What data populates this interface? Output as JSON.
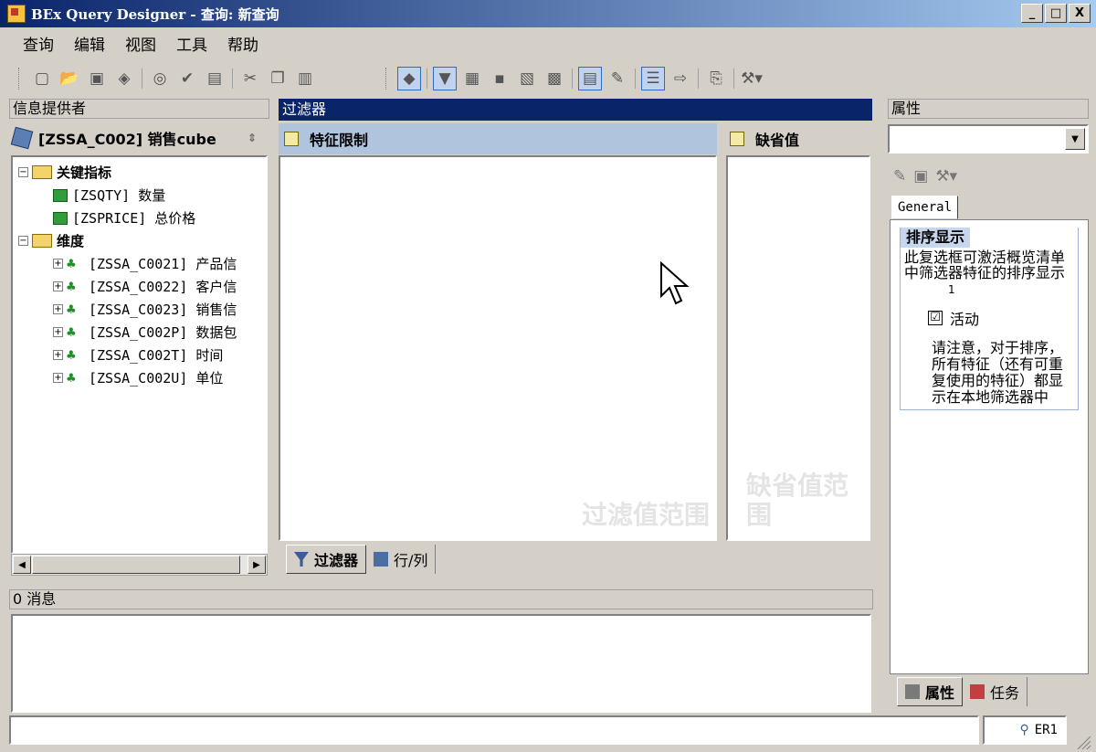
{
  "window": {
    "title": "BEx Query Designer - 查询: 新查询",
    "min": "_",
    "max": "□",
    "close": "X"
  },
  "menu": [
    "查询",
    "编辑",
    "视图",
    "工具",
    "帮助"
  ],
  "left_panel": {
    "header": "信息提供者",
    "provider": "[ZSSA_C002] 销售cube",
    "tree": [
      {
        "label": "关键指标",
        "kind": "folder",
        "level": 0,
        "toggle": "−"
      },
      {
        "label": "[ZSQTY] 数量",
        "kind": "keyfigure",
        "level": 1
      },
      {
        "label": "[ZSPRICE] 总价格",
        "kind": "keyfigure",
        "level": 1
      },
      {
        "label": "维度",
        "kind": "folder",
        "level": 0,
        "toggle": "−"
      },
      {
        "label": "[ZSSA_C0021] 产品信",
        "kind": "dimension",
        "level": 1,
        "toggle": "+"
      },
      {
        "label": "[ZSSA_C0022] 客户信",
        "kind": "dimension",
        "level": 1,
        "toggle": "+"
      },
      {
        "label": "[ZSSA_C0023] 销售信",
        "kind": "dimension",
        "level": 1,
        "toggle": "+"
      },
      {
        "label": "[ZSSA_C002P] 数据包",
        "kind": "dimension",
        "level": 1,
        "toggle": "+"
      },
      {
        "label": "[ZSSA_C002T] 时间",
        "kind": "dimension",
        "level": 1,
        "toggle": "+"
      },
      {
        "label": "[ZSSA_C002U] 单位",
        "kind": "dimension",
        "level": 1,
        "toggle": "+"
      }
    ]
  },
  "filter_panel": {
    "header": "过滤器",
    "char_restrictions": "特征限制",
    "default_values": "缺省值",
    "char_watermark": "过滤值范围",
    "default_watermark": "缺省值范围",
    "tabs": [
      {
        "label": "过滤器",
        "selected": true
      },
      {
        "label": "行/列",
        "selected": false
      }
    ]
  },
  "messages": {
    "header": "0 消息"
  },
  "properties_panel": {
    "header": "属性",
    "tab": "General",
    "section_title": "排序显示",
    "description": "此复选框可激活概览清单中筛选器特征的排序显示",
    "number": "1",
    "checkbox_label": "活动",
    "checkbox_mark": "☑",
    "note": "请注意，对于排序，所有特征（还有可重复使用的特征）都显示在本地筛选器中",
    "bottom_tabs": [
      {
        "label": "属性",
        "selected": true
      },
      {
        "label": "任务",
        "selected": false
      }
    ]
  },
  "status": {
    "system": "ER1"
  },
  "colors": {
    "title_start": "#0a246a",
    "title_end": "#a6caf0",
    "selected_header": "#b0c4de",
    "filter_header": "#0a246a"
  }
}
